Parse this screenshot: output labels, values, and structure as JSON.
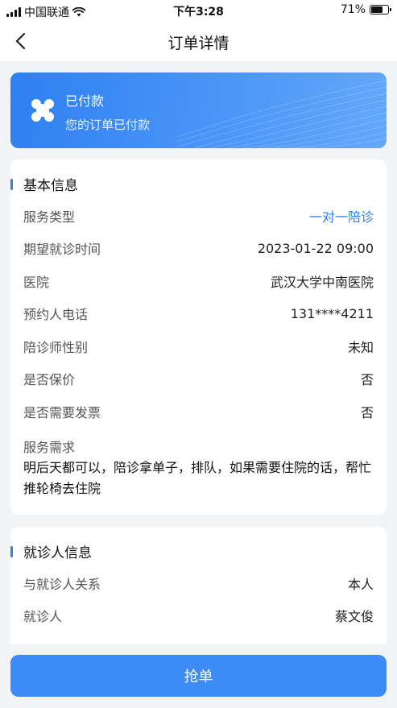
{
  "status_bar": {
    "carrier": "中国联通",
    "time": "下午3:28",
    "battery_percent_text": "71%",
    "battery_level": 0.71
  },
  "nav": {
    "back_icon": "chevron-left-icon",
    "title": "订单详情"
  },
  "order_status": {
    "icon": "clover-icon",
    "title": "已付款",
    "subtitle": "您的订单已付款",
    "gradient_from": "#2e7ff2",
    "gradient_to": "#64a8fa"
  },
  "basic_info": {
    "title": "基本信息",
    "rows": [
      {
        "label": "服务类型",
        "value": "一对一陪诊"
      },
      {
        "label": "期望就诊时间",
        "value": "2023-01-22 09:00"
      },
      {
        "label": "医院",
        "value": "武汉大学中南医院"
      },
      {
        "label": "预约人电话",
        "value": "131****4211"
      },
      {
        "label": "陪诊师性别",
        "value": "未知"
      },
      {
        "label": "是否保价",
        "value": "否"
      },
      {
        "label": "是否需要发票",
        "value": "否"
      }
    ],
    "request_label": "服务需求",
    "request_text": "明后天都可以，陪诊拿单子，排队，如果需要住院的话，帮忙推轮椅去住院"
  },
  "patient_info": {
    "title": "就诊人信息",
    "rows": [
      {
        "label": "与就诊人关系",
        "value": "本人"
      },
      {
        "label": "就诊人",
        "value": "蔡文俊"
      }
    ]
  },
  "action": {
    "grab_label": "抢单"
  },
  "colors": {
    "accent": "#2f80ed",
    "button": "#3d8bf5",
    "background": "#f2f3f5"
  }
}
